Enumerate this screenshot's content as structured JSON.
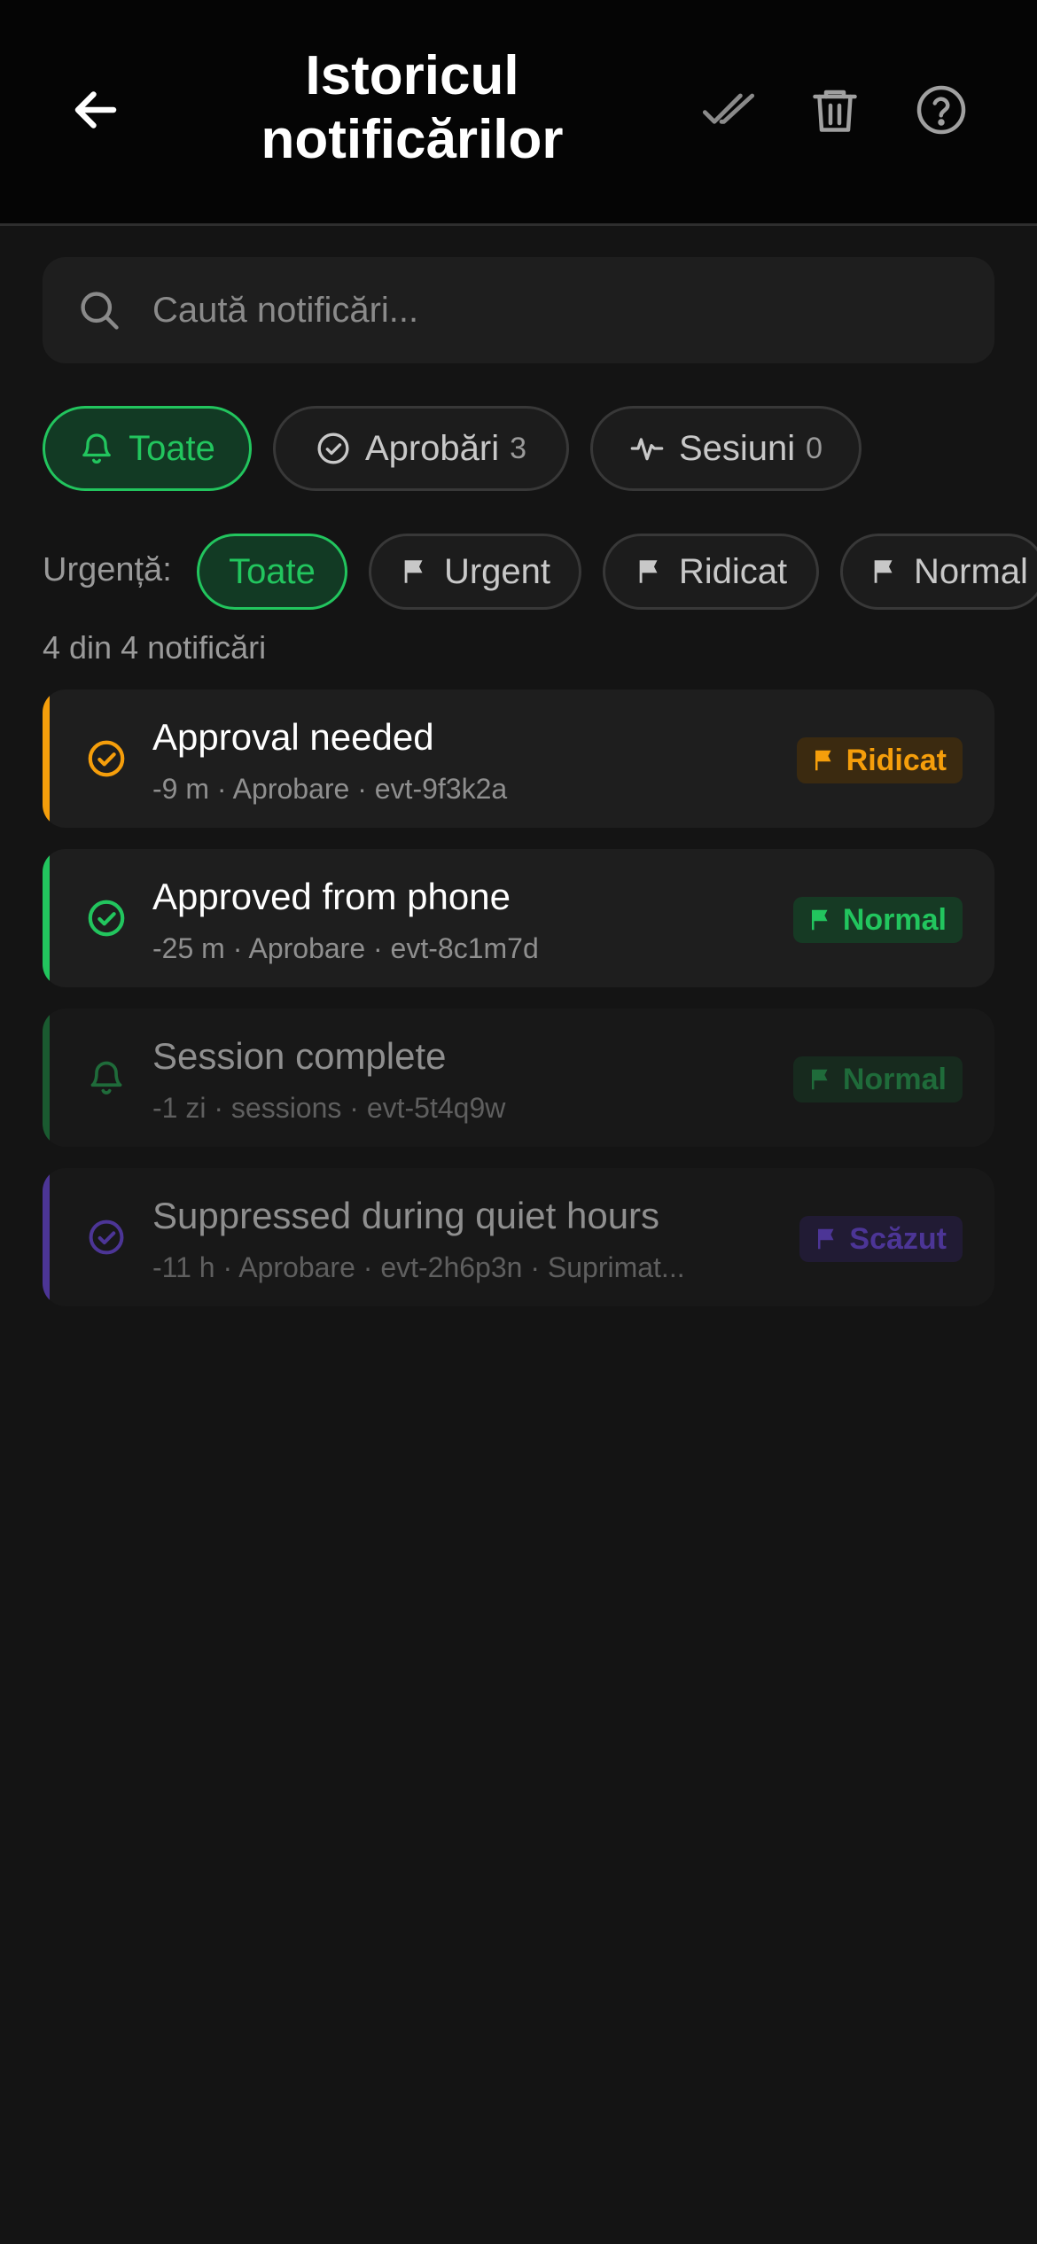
{
  "header": {
    "title_line1": "Istoricul",
    "title_line2": "notificărilor",
    "icons": [
      "arrow-left-icon",
      "double-check-icon",
      "trash-icon",
      "help-icon"
    ]
  },
  "search": {
    "placeholder": "Caută notificări..."
  },
  "type_filters": [
    {
      "label": "Toate",
      "icon": "bell-icon",
      "active": true
    },
    {
      "label": "Aprobări",
      "count": "3",
      "icon": "check-circle-icon",
      "active": false
    },
    {
      "label": "Sesiuni",
      "count": "0",
      "icon": "activity-icon",
      "active": false
    }
  ],
  "urgency": {
    "label": "Urgență:",
    "filters": [
      {
        "label": "Toate",
        "active": true
      },
      {
        "label": "Urgent",
        "icon": "flag-icon"
      },
      {
        "label": "Ridicat",
        "icon": "flag-icon"
      },
      {
        "label": "Normal",
        "icon": "flag-icon"
      }
    ]
  },
  "summary": "4 din 4 notificări",
  "notifications": [
    {
      "title": "Approval needed",
      "meta": "-9 m · Aprobare · evt-9f3k2a",
      "badge": "Ridicat",
      "icon": "check-circle-icon",
      "color": "#f59e0b"
    },
    {
      "title": "Approved from phone",
      "meta": "-25 m · Aprobare · evt-8c1m7d",
      "badge": "Normal",
      "icon": "check-circle-icon",
      "color": "#22c55e"
    },
    {
      "title": "Session complete",
      "meta": "-1 zi · sessions · evt-5t4q9w",
      "badge": "Normal",
      "icon": "bell-icon",
      "color": "#22c55e",
      "dimmed": true
    },
    {
      "title": "Suppressed during quiet hours",
      "meta": "-11 h · Aprobare · evt-2h6p3n · Suprimat...",
      "badge": "Scăzut",
      "icon": "check-circle-icon",
      "color": "#6d4bc9",
      "dimmed": true
    }
  ],
  "colors": {
    "accent": "#22c55e",
    "high": "#f59e0b",
    "low": "#6d4bc9",
    "background": "#141414"
  }
}
